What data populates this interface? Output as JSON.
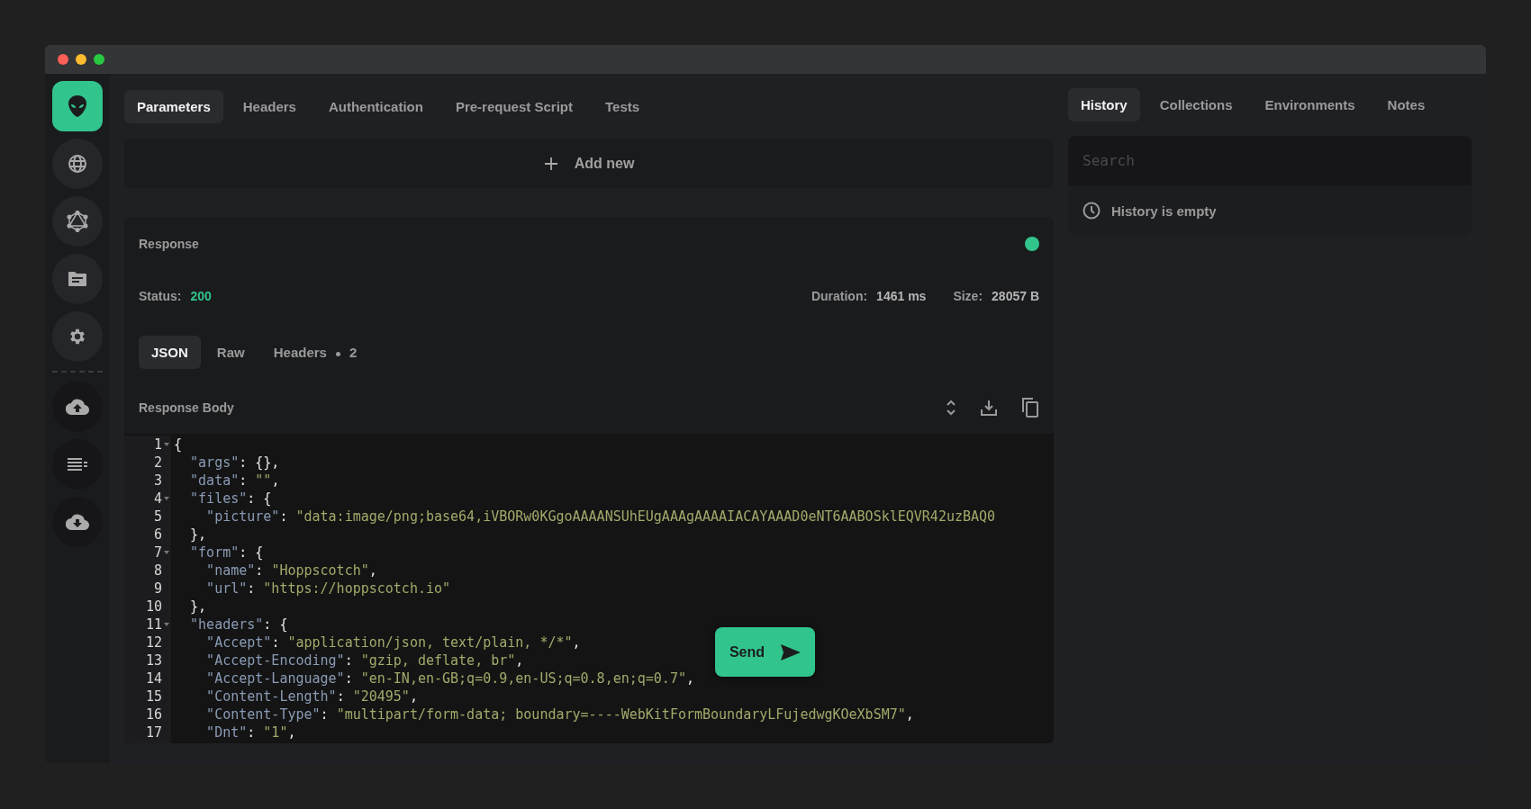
{
  "nav_items": [
    {
      "selected": true
    },
    {
      "selected": false
    },
    {
      "selected": false
    },
    {
      "selected": false
    },
    {
      "selected": false
    }
  ],
  "request_tabs": [
    {
      "label": "Parameters",
      "selected": true
    },
    {
      "label": "Headers",
      "selected": false
    },
    {
      "label": "Authentication",
      "selected": false
    },
    {
      "label": "Pre-request Script",
      "selected": false
    },
    {
      "label": "Tests",
      "selected": false
    }
  ],
  "add_new": {
    "label": "Add new"
  },
  "response": {
    "title": "Response",
    "status_label": "Status:",
    "status": "200",
    "duration_label": "Duration:",
    "duration": "1461 ms",
    "size_label": "Size:",
    "size": "28057 B",
    "view_tabs": [
      {
        "label": "JSON",
        "selected": true
      },
      {
        "label": "Raw",
        "selected": false
      },
      {
        "label": "Headers",
        "count": "2",
        "selected": false
      }
    ],
    "body_title": "Response Body",
    "lines": [
      {
        "number": "1",
        "foldable": true,
        "tokens": [
          {
            "kind": "punct",
            "text": "{"
          }
        ]
      },
      {
        "number": "2",
        "foldable": false,
        "tokens": [
          {
            "kind": "key",
            "text": "  \"args\""
          },
          {
            "kind": "punct",
            "text": ": {},"
          }
        ]
      },
      {
        "number": "3",
        "foldable": false,
        "tokens": [
          {
            "kind": "key",
            "text": "  \"data\""
          },
          {
            "kind": "punct",
            "text": ": "
          },
          {
            "kind": "string",
            "text": "\"\""
          },
          {
            "kind": "punct",
            "text": ","
          }
        ]
      },
      {
        "number": "4",
        "foldable": true,
        "tokens": [
          {
            "kind": "key",
            "text": "  \"files\""
          },
          {
            "kind": "punct",
            "text": ": {"
          }
        ]
      },
      {
        "number": "5",
        "foldable": false,
        "tokens": [
          {
            "kind": "key",
            "text": "    \"picture\""
          },
          {
            "kind": "punct",
            "text": ": "
          },
          {
            "kind": "string",
            "text": "\"data:image/png;base64,iVBORw0KGgoAAAANSUhEUgAAAgAAAAIACAYAAAD0eNT6AABOSklEQVR42uzBAQ0"
          }
        ]
      },
      {
        "number": "6",
        "foldable": false,
        "tokens": [
          {
            "kind": "punct",
            "text": "  },"
          }
        ]
      },
      {
        "number": "7",
        "foldable": true,
        "tokens": [
          {
            "kind": "key",
            "text": "  \"form\""
          },
          {
            "kind": "punct",
            "text": ": {"
          }
        ]
      },
      {
        "number": "8",
        "foldable": false,
        "tokens": [
          {
            "kind": "key",
            "text": "    \"name\""
          },
          {
            "kind": "punct",
            "text": ": "
          },
          {
            "kind": "string",
            "text": "\"Hoppscotch\""
          },
          {
            "kind": "punct",
            "text": ","
          }
        ]
      },
      {
        "number": "9",
        "foldable": false,
        "tokens": [
          {
            "kind": "key",
            "text": "    \"url\""
          },
          {
            "kind": "punct",
            "text": ": "
          },
          {
            "kind": "string",
            "text": "\"https://hoppscotch.io\""
          }
        ]
      },
      {
        "number": "10",
        "foldable": false,
        "tokens": [
          {
            "kind": "punct",
            "text": "  },"
          }
        ]
      },
      {
        "number": "11",
        "foldable": true,
        "tokens": [
          {
            "kind": "key",
            "text": "  \"headers\""
          },
          {
            "kind": "punct",
            "text": ": {"
          }
        ]
      },
      {
        "number": "12",
        "foldable": false,
        "tokens": [
          {
            "kind": "key",
            "text": "    \"Accept\""
          },
          {
            "kind": "punct",
            "text": ": "
          },
          {
            "kind": "string",
            "text": "\"application/json, text/plain, */*\""
          },
          {
            "kind": "punct",
            "text": ","
          }
        ]
      },
      {
        "number": "13",
        "foldable": false,
        "tokens": [
          {
            "kind": "key",
            "text": "    \"Accept-Encoding\""
          },
          {
            "kind": "punct",
            "text": ": "
          },
          {
            "kind": "string",
            "text": "\"gzip, deflate, br\""
          },
          {
            "kind": "punct",
            "text": ","
          }
        ]
      },
      {
        "number": "14",
        "foldable": false,
        "tokens": [
          {
            "kind": "key",
            "text": "    \"Accept-Language\""
          },
          {
            "kind": "punct",
            "text": ": "
          },
          {
            "kind": "string",
            "text": "\"en-IN,en-GB;q=0.9,en-US;q=0.8,en;q=0.7\""
          },
          {
            "kind": "punct",
            "text": ","
          }
        ]
      },
      {
        "number": "15",
        "foldable": false,
        "tokens": [
          {
            "kind": "key",
            "text": "    \"Content-Length\""
          },
          {
            "kind": "punct",
            "text": ": "
          },
          {
            "kind": "string",
            "text": "\"20495\""
          },
          {
            "kind": "punct",
            "text": ","
          }
        ]
      },
      {
        "number": "16",
        "foldable": false,
        "tokens": [
          {
            "kind": "key",
            "text": "    \"Content-Type\""
          },
          {
            "kind": "punct",
            "text": ": "
          },
          {
            "kind": "string",
            "text": "\"multipart/form-data; boundary=----WebKitFormBoundaryLFujedwgKOeXbSM7\""
          },
          {
            "kind": "punct",
            "text": ","
          }
        ]
      },
      {
        "number": "17",
        "foldable": false,
        "tokens": [
          {
            "kind": "key",
            "text": "    \"Dnt\""
          },
          {
            "kind": "punct",
            "text": ": "
          },
          {
            "kind": "string",
            "text": "\"1\""
          },
          {
            "kind": "punct",
            "text": ","
          }
        ]
      }
    ]
  },
  "send_button": {
    "label": "Send"
  },
  "side_tabs": [
    {
      "label": "History",
      "selected": true
    },
    {
      "label": "Collections",
      "selected": false
    },
    {
      "label": "Environments",
      "selected": false
    },
    {
      "label": "Notes",
      "selected": false
    }
  ],
  "search": {
    "placeholder": "Search"
  },
  "history_empty": "History is empty"
}
